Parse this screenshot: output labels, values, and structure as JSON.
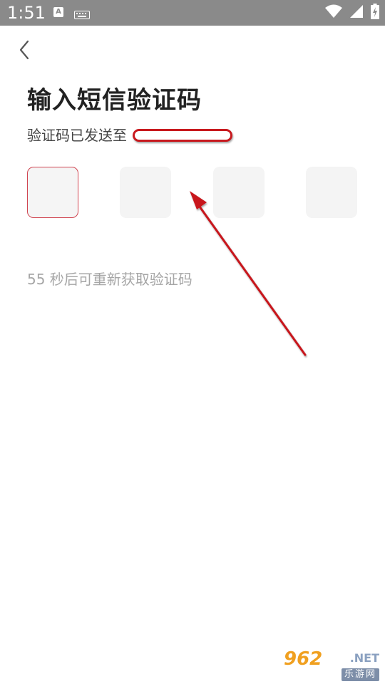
{
  "status_bar": {
    "time": "1:51",
    "notification_icon_letter": "A",
    "icons": [
      "app-notification-icon",
      "keyboard-icon",
      "wifi-icon",
      "signal-icon",
      "battery-charging-icon"
    ]
  },
  "header": {
    "back_icon": "chevron-left-icon"
  },
  "main": {
    "title": "输入短信验证码",
    "sent_to_label": "验证码已发送至",
    "code_length": 4,
    "resend_countdown": "55 秒后可重新获取验证码"
  },
  "watermark": {
    "main": "962",
    "net": ".NET",
    "sub": "乐游网"
  },
  "colors": {
    "status_bar_bg": "#8a8a8a",
    "title": "#222222",
    "active_border": "#d04450",
    "box_bg": "#f4f4f4",
    "hint_text": "#a6a6a6",
    "annotation_red": "#c8191e"
  }
}
